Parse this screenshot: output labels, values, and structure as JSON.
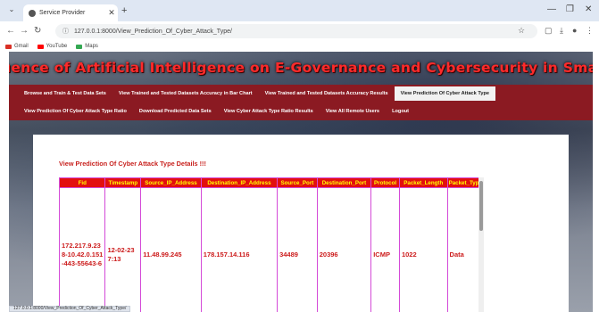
{
  "browser": {
    "tab_title": "Service Provider",
    "url": "127.0.0.1:8000/View_Prediction_Of_Cyber_Attack_Type/",
    "bookmarks": [
      {
        "label": "Gmail",
        "color": "#d93025"
      },
      {
        "label": "YouTube",
        "color": "#ff0000"
      },
      {
        "label": "Maps",
        "color": "#34a853"
      }
    ],
    "status_text": "127.0.0.1:8000/View_Prediction_Of_Cyber_Attack_Type/"
  },
  "site": {
    "title": "The Influence of Artificial Intelligence on E-Governance and Cybersecurity in Smart Cities",
    "menu_row1": [
      {
        "label": "Browse and Train & Test Data Sets",
        "active": false
      },
      {
        "label": "View Trained and Tested Datasets Accuracy in Bar Chart",
        "active": false
      },
      {
        "label": "View Trained and Tested Datasets Accuracy Results",
        "active": false
      },
      {
        "label": "View Prediction Of Cyber Attack Type",
        "active": true
      }
    ],
    "menu_row2": [
      {
        "label": "View Prediction Of Cyber Attack Type Ratio",
        "active": false
      },
      {
        "label": "Download Predicted Data Sets",
        "active": false
      },
      {
        "label": "View Cyber Attack Type Ratio Results",
        "active": false
      },
      {
        "label": "View All Remote Users",
        "active": false
      },
      {
        "label": "Logout",
        "active": false
      }
    ]
  },
  "details": {
    "heading": "View Prediction Of Cyber Attack Type Details !!!",
    "columns": [
      "Fid",
      "Timestamp",
      "Source_IP_Address",
      "Destination_IP_Address",
      "Source_Port",
      "Destination_Port",
      "Protocol",
      "Packet_Length",
      "Packet_Type"
    ],
    "rows": [
      [
        "172.217.9.238-10.42.0.151-443-55643-6",
        "12-02-23 7:13",
        "11.48.99.245",
        "178.157.14.116",
        "34489",
        "20396",
        "ICMP",
        "1022",
        "Data"
      ]
    ]
  },
  "colors": {
    "title_red": "#ff2a2a",
    "menu_bg": "#8b1a22",
    "header_bg": "#e30f0f",
    "header_text": "#ffff00",
    "cell_text": "#cc1b1b",
    "border": "#d44ad8"
  }
}
